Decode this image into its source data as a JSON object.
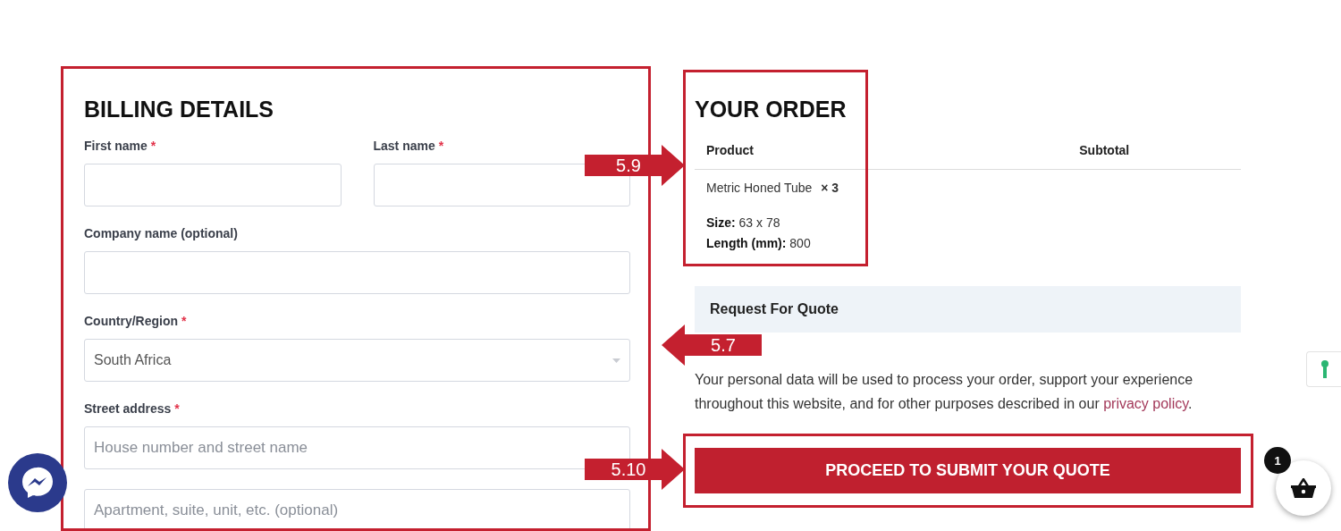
{
  "billing": {
    "title": "BILLING DETAILS",
    "rows": [
      {
        "fields": [
          {
            "label": "First name",
            "required_mark": "*",
            "kind": "text"
          },
          {
            "label": "Last name",
            "required_mark": "*",
            "kind": "text"
          }
        ]
      },
      {
        "fields": [
          {
            "label": "Company name (optional)",
            "kind": "text"
          }
        ]
      },
      {
        "fields": [
          {
            "label": "Country/Region",
            "required_mark": "*",
            "kind": "select",
            "value": "South Africa"
          }
        ]
      },
      {
        "fields": [
          {
            "label": "Street address",
            "required_mark": "*",
            "kind": "text",
            "placeholder": "House number and street name"
          }
        ]
      },
      {
        "fields": [
          {
            "kind": "text",
            "placeholder": "Apartment, suite, unit, etc. (optional)"
          }
        ]
      }
    ]
  },
  "order": {
    "title": "YOUR ORDER",
    "columns": [
      "Product",
      "Subtotal"
    ],
    "items": [
      {
        "name": "Metric Honed Tube",
        "quantity": "× 3",
        "attributes": [
          {
            "label": "Size:",
            "value": "63 x 78"
          },
          {
            "label": "Length (mm):",
            "value": "800"
          }
        ]
      }
    ],
    "payment_method": "Request For Quote",
    "privacy_text": "Your personal data will be used to process your order, support your experience throughout this website, and for other purposes described in our",
    "privacy_link": "privacy policy",
    "privacy_end": ".",
    "submit_button": "PROCEED TO SUBMIT YOUR QUOTE"
  },
  "annotations": [
    {
      "label": "5.9",
      "kind": "right"
    },
    {
      "label": "5.7",
      "kind": "left"
    },
    {
      "label": "5.10",
      "kind": "right"
    }
  ],
  "cart": {
    "count": "1"
  }
}
